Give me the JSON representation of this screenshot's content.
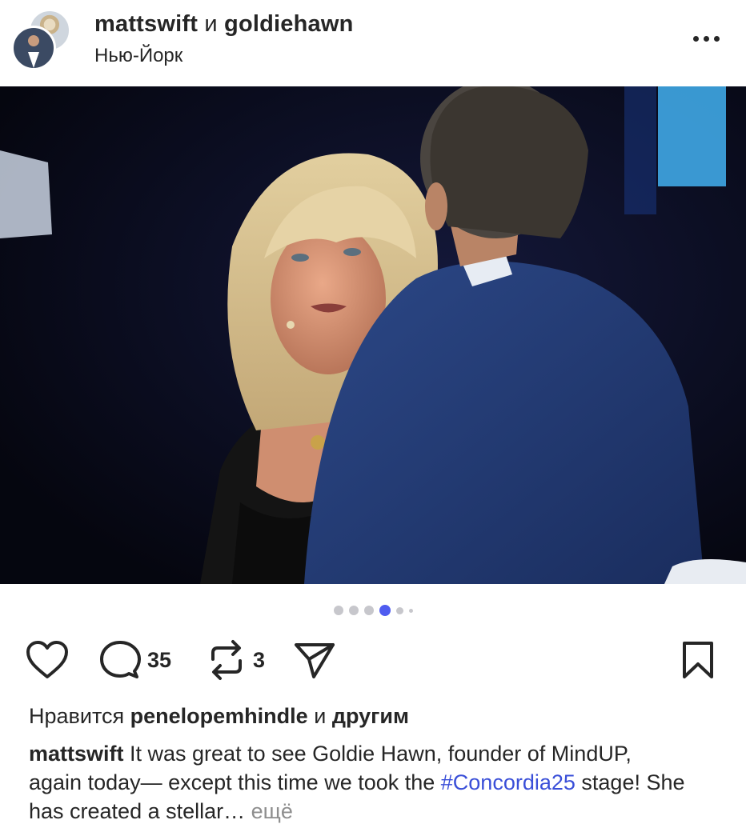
{
  "header": {
    "author_1": "mattswift",
    "joiner": "и",
    "author_2": "goldiehawn",
    "location": "Нью-Йорк",
    "more_icon": "more-horizontal-icon"
  },
  "post": {
    "carousel": {
      "total_dots": 6,
      "active_index": 3
    }
  },
  "actions": {
    "like_icon": "heart-icon",
    "comment_icon": "comment-bubble-icon",
    "comments_count": "35",
    "repost_icon": "repost-icon",
    "reposts_count": "3",
    "share_icon": "paper-plane-icon",
    "bookmark_icon": "bookmark-icon"
  },
  "likes": {
    "prefix": "Нравится",
    "user": "penelopemhindle",
    "joiner": "и",
    "others": "другим"
  },
  "caption": {
    "author": "mattswift",
    "text_1": " It was great to see Goldie Hawn, founder of MindUP, again today— except this time we took the ",
    "hashtag": "#Concordia25",
    "text_2": " stage! She has created a stellar… ",
    "more": "ещё"
  },
  "colors": {
    "text": "#262626",
    "accent_dot": "#4f5cf0",
    "hashtag": "#3a4fd8",
    "muted": "#8e8e8e"
  }
}
